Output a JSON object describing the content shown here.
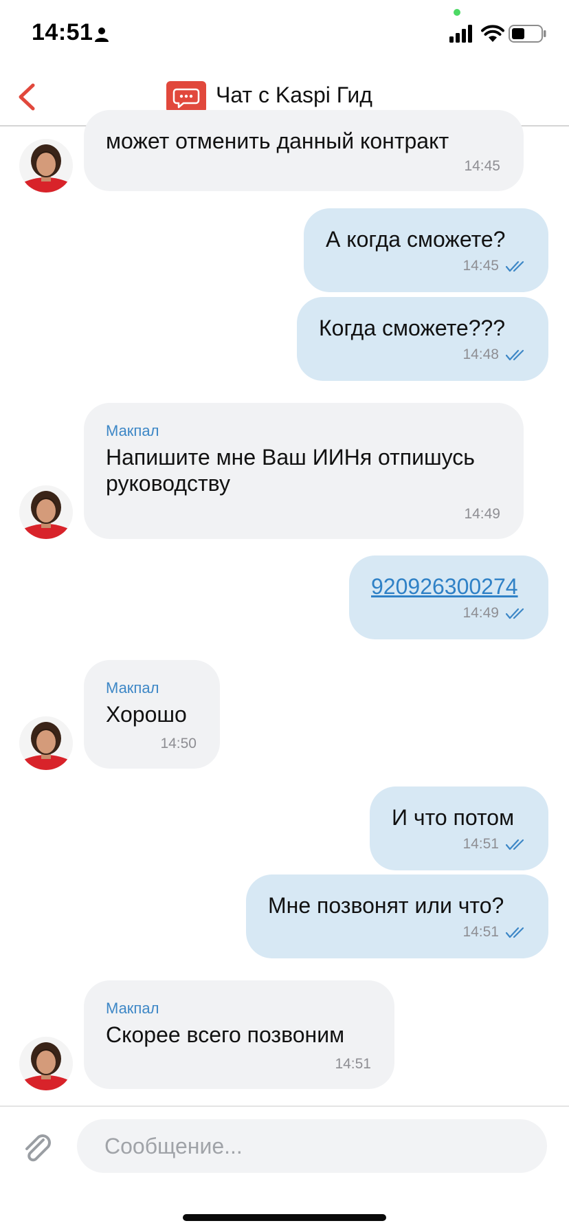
{
  "status_bar": {
    "time": "14:51",
    "icons": [
      "person-icon",
      "signal-icon",
      "wifi-icon",
      "battery-icon"
    ],
    "dot_color": "#4cd964"
  },
  "header": {
    "back_icon": "chevron-left-icon",
    "chat_icon": "chat-bubble-icon",
    "title": "Чат с Kaspi Гид",
    "accent_color": "#e1483c"
  },
  "messages": [
    {
      "dir": "in",
      "text": "может отменить данный контракт",
      "time": "14:45"
    },
    {
      "dir": "out",
      "text": "А когда сможете?",
      "time": "14:45",
      "read": true
    },
    {
      "dir": "out",
      "text": "Когда сможете???",
      "time": "14:48",
      "read": true
    },
    {
      "dir": "in",
      "sender": "Макпал",
      "text": "Напишите мне Ваш ИИНя отпишусь руководству",
      "time": "14:49"
    },
    {
      "dir": "out",
      "text": "920926300274",
      "time": "14:49",
      "read": true,
      "is_link": true
    },
    {
      "dir": "in",
      "sender": "Макпал",
      "text": "Хорошо",
      "time": "14:50"
    },
    {
      "dir": "out",
      "text": "И что потом",
      "time": "14:51",
      "read": true
    },
    {
      "dir": "out",
      "text": "Мне позвонят или что?",
      "time": "14:51",
      "read": true
    },
    {
      "dir": "in",
      "sender": "Макпал",
      "text": "Скорее всего позвоним",
      "time": "14:51"
    }
  ],
  "composer": {
    "attach_icon": "paperclip-icon",
    "placeholder": "Сообщение..."
  },
  "colors": {
    "incoming_bubble": "#f1f2f4",
    "outgoing_bubble": "#d7e8f4",
    "sender_name": "#3d87c6",
    "link": "#2f81c6",
    "check": "#3d87c6"
  }
}
